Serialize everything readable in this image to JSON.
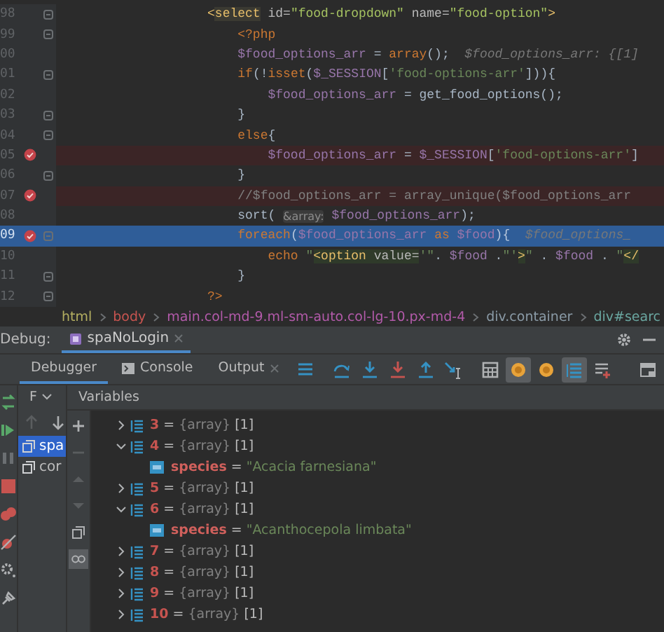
{
  "editor": {
    "lines": [
      {
        "number": "98",
        "breakpoint": false,
        "current": false,
        "fold": true,
        "tokens": [
          {
            "kind": "tag",
            "text": "                    <"
          },
          {
            "kind": "tagname",
            "text": "select"
          },
          {
            "kind": "attr",
            "text": " id="
          },
          {
            "kind": "val",
            "text": "\"food-dropdown\""
          },
          {
            "kind": "attr",
            "text": " name="
          },
          {
            "kind": "val",
            "text": "\"food-option\""
          },
          {
            "kind": "tag",
            "text": ">"
          }
        ]
      },
      {
        "number": "99",
        "breakpoint": false,
        "current": false,
        "fold": true,
        "tokens": [
          {
            "kind": "php",
            "text": "                        <?php"
          }
        ]
      },
      {
        "number": "00",
        "breakpoint": false,
        "current": false,
        "fold": false,
        "tokens": [
          {
            "kind": "var",
            "text": "                        $food_options_arr"
          },
          {
            "kind": "plain",
            "text": " = "
          },
          {
            "kind": "kw",
            "text": "array"
          },
          {
            "kind": "plain",
            "text": "();  "
          },
          {
            "kind": "hint",
            "text": "$food_options_arr: {[1]"
          }
        ]
      },
      {
        "number": "01",
        "breakpoint": false,
        "current": false,
        "fold": true,
        "tokens": [
          {
            "kind": "kw",
            "text": "                        if"
          },
          {
            "kind": "plain",
            "text": "(!"
          },
          {
            "kind": "kw",
            "text": "isset"
          },
          {
            "kind": "plain",
            "text": "("
          },
          {
            "kind": "var",
            "text": "$_SESSION"
          },
          {
            "kind": "plain",
            "text": "["
          },
          {
            "kind": "str",
            "text": "'food-options-arr'"
          },
          {
            "kind": "plain",
            "text": "])){"
          }
        ]
      },
      {
        "number": "02",
        "breakpoint": false,
        "current": false,
        "fold": false,
        "tokens": [
          {
            "kind": "var",
            "text": "                            $food_options_arr"
          },
          {
            "kind": "plain",
            "text": " = get_food_options();"
          }
        ]
      },
      {
        "number": "03",
        "breakpoint": false,
        "current": false,
        "fold": true,
        "tokens": [
          {
            "kind": "plain",
            "text": "                        }"
          }
        ]
      },
      {
        "number": "04",
        "breakpoint": false,
        "current": false,
        "fold": true,
        "tokens": [
          {
            "kind": "kw",
            "text": "                        else"
          },
          {
            "kind": "plain",
            "text": "{"
          }
        ]
      },
      {
        "number": "05",
        "breakpoint": true,
        "current": false,
        "fold": false,
        "tokens": [
          {
            "kind": "var",
            "text": "                            $food_options_arr"
          },
          {
            "kind": "plain",
            "text": " = "
          },
          {
            "kind": "var",
            "text": "$_SESSION"
          },
          {
            "kind": "plain",
            "text": "["
          },
          {
            "kind": "str",
            "text": "'food-options-arr'"
          },
          {
            "kind": "plain",
            "text": "]"
          }
        ]
      },
      {
        "number": "06",
        "breakpoint": false,
        "current": false,
        "fold": true,
        "tokens": [
          {
            "kind": "plain",
            "text": "                        }"
          }
        ]
      },
      {
        "number": "07",
        "breakpoint": true,
        "current": false,
        "fold": false,
        "tokens": [
          {
            "kind": "comment",
            "text": "                        //$food_options_arr = array_unique($food_options_arr"
          }
        ]
      },
      {
        "number": "08",
        "breakpoint": false,
        "current": false,
        "fold": false,
        "tokens": [
          {
            "kind": "plain",
            "text": "                        sort( "
          },
          {
            "kind": "chip",
            "text": "&array:"
          },
          {
            "kind": "var",
            "text": " $food_options_arr"
          },
          {
            "kind": "plain",
            "text": ");"
          }
        ]
      },
      {
        "number": "09",
        "breakpoint": true,
        "current": true,
        "fold": true,
        "tokens": [
          {
            "kind": "kw",
            "text": "                        foreach"
          },
          {
            "kind": "plain",
            "text": "("
          },
          {
            "kind": "var",
            "text": "$food_options_arr"
          },
          {
            "kind": "kw",
            "text": " as "
          },
          {
            "kind": "var",
            "text": "$food"
          },
          {
            "kind": "plain",
            "text": "){  "
          },
          {
            "kind": "hint",
            "text": "$food_options_"
          }
        ]
      },
      {
        "number": "10",
        "breakpoint": false,
        "current": false,
        "fold": false,
        "tokens": [
          {
            "kind": "kw",
            "text": "                            echo"
          },
          {
            "kind": "str",
            "text": " \""
          },
          {
            "kind": "htag",
            "text": "<option"
          },
          {
            "kind": "hattr",
            "text": " value="
          },
          {
            "kind": "str",
            "text": "'\""
          },
          {
            "kind": "plain",
            "text": ". "
          },
          {
            "kind": "var",
            "text": "$food"
          },
          {
            "kind": "plain",
            "text": " ."
          },
          {
            "kind": "str",
            "text": "\"'"
          },
          {
            "kind": "htag",
            "text": ">"
          },
          {
            "kind": "str",
            "text": "\""
          },
          {
            "kind": "plain",
            "text": " . "
          },
          {
            "kind": "var",
            "text": "$food"
          },
          {
            "kind": "plain",
            "text": " . "
          },
          {
            "kind": "str",
            "text": "\""
          },
          {
            "kind": "htag",
            "text": "</"
          }
        ]
      },
      {
        "number": "11",
        "breakpoint": false,
        "current": false,
        "fold": true,
        "tokens": [
          {
            "kind": "plain",
            "text": "                        }"
          }
        ]
      },
      {
        "number": "12",
        "breakpoint": false,
        "current": false,
        "fold": true,
        "tokens": [
          {
            "kind": "php",
            "text": "                    ?>"
          }
        ]
      }
    ]
  },
  "breadcrumbs": [
    {
      "label": "html",
      "color": "#b3ae60"
    },
    {
      "label": "body",
      "color": "#c75450"
    },
    {
      "label": "main.col-md-9.ml-sm-auto.col-lg-10.px-md-4",
      "color": "#b25aa9"
    },
    {
      "label": "div.container",
      "color": "#8a9aa6"
    },
    {
      "label": "div#searc",
      "color": "#6aa6a0"
    }
  ],
  "debug": {
    "title": "Debug:",
    "session": "spaNoLogin",
    "tabs": [
      {
        "label": "Debugger",
        "selected": true,
        "kind": "plain"
      },
      {
        "label": "Console",
        "selected": false,
        "kind": "console"
      },
      {
        "label": "Output",
        "selected": false,
        "kind": "closable"
      }
    ],
    "toolbar": [
      {
        "kind": "lines",
        "on": false
      },
      {
        "kind": "step-over",
        "on": false
      },
      {
        "kind": "step-into",
        "on": false
      },
      {
        "kind": "force-step-into",
        "on": false
      },
      {
        "kind": "step-out",
        "on": false
      },
      {
        "kind": "run-to-cursor",
        "on": false
      },
      {
        "kind": "grid",
        "on": false
      },
      {
        "kind": "dot",
        "on": true
      },
      {
        "kind": "dot",
        "on": false
      },
      {
        "kind": "list",
        "on": true
      },
      {
        "kind": "stream",
        "on": false
      }
    ],
    "frames_header": "F",
    "frames": [
      {
        "label": "spa",
        "selected": true
      },
      {
        "label": "cor",
        "selected": false
      }
    ],
    "variables_header": "Variables",
    "variables": [
      {
        "name": "3",
        "operator": "=",
        "type": "{array}",
        "count": "[1]",
        "expanded": false
      },
      {
        "name": "4",
        "operator": "=",
        "type": "{array}",
        "count": "[1]",
        "expanded": true,
        "children": [
          {
            "name": "species",
            "operator": "=",
            "value": "\"Acacia farnesiana\""
          }
        ]
      },
      {
        "name": "5",
        "operator": "=",
        "type": "{array}",
        "count": "[1]",
        "expanded": false
      },
      {
        "name": "6",
        "operator": "=",
        "type": "{array}",
        "count": "[1]",
        "expanded": true,
        "children": [
          {
            "name": "species",
            "operator": "=",
            "value": "\"Acanthocepola limbata\""
          }
        ]
      },
      {
        "name": "7",
        "operator": "=",
        "type": "{array}",
        "count": "[1]",
        "expanded": false
      },
      {
        "name": "8",
        "operator": "=",
        "type": "{array}",
        "count": "[1]",
        "expanded": false
      },
      {
        "name": "9",
        "operator": "=",
        "type": "{array}",
        "count": "[1]",
        "expanded": false
      },
      {
        "name": "10",
        "operator": "=",
        "type": "{array}",
        "count": "[1]",
        "expanded": false
      }
    ]
  }
}
